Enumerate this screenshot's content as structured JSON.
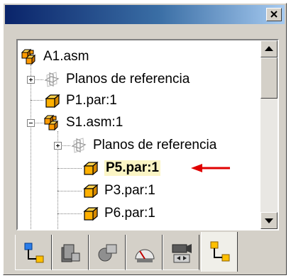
{
  "window": {
    "close_label": "×"
  },
  "tree": {
    "items": [
      {
        "label": "A1.asm",
        "icon": "assembly-icon"
      },
      {
        "label": "Planos de referencia",
        "icon": "reference-planes-icon"
      },
      {
        "label": "P1.par:1",
        "icon": "part-icon"
      },
      {
        "label": "S1.asm:1",
        "icon": "assembly-icon"
      },
      {
        "label": "Planos de referencia",
        "icon": "reference-planes-icon"
      },
      {
        "label": "P5.par:1",
        "icon": "part-icon",
        "selected": true
      },
      {
        "label": "P3.par:1",
        "icon": "part-icon"
      },
      {
        "label": "P6.par:1",
        "icon": "part-icon"
      }
    ]
  },
  "tabs": [
    {
      "name": "assembly-pathfinder-tab",
      "icon": "tree-hierarchy-icon"
    },
    {
      "name": "parts-library-tab",
      "icon": "parts-library-icon"
    },
    {
      "name": "feature-library-tab",
      "icon": "feature-library-icon"
    },
    {
      "name": "sensors-tab",
      "icon": "gauge-icon"
    },
    {
      "name": "animation-tab",
      "icon": "camera-icon"
    },
    {
      "name": "pathfinder-active-tab",
      "icon": "tree-hierarchy-icon",
      "active": true
    }
  ],
  "colors": {
    "selection_highlight": "#fbf5c4",
    "annotation_arrow": "#e00000",
    "title_gradient_start": "#0a246a",
    "title_gradient_end": "#a6caf0"
  }
}
